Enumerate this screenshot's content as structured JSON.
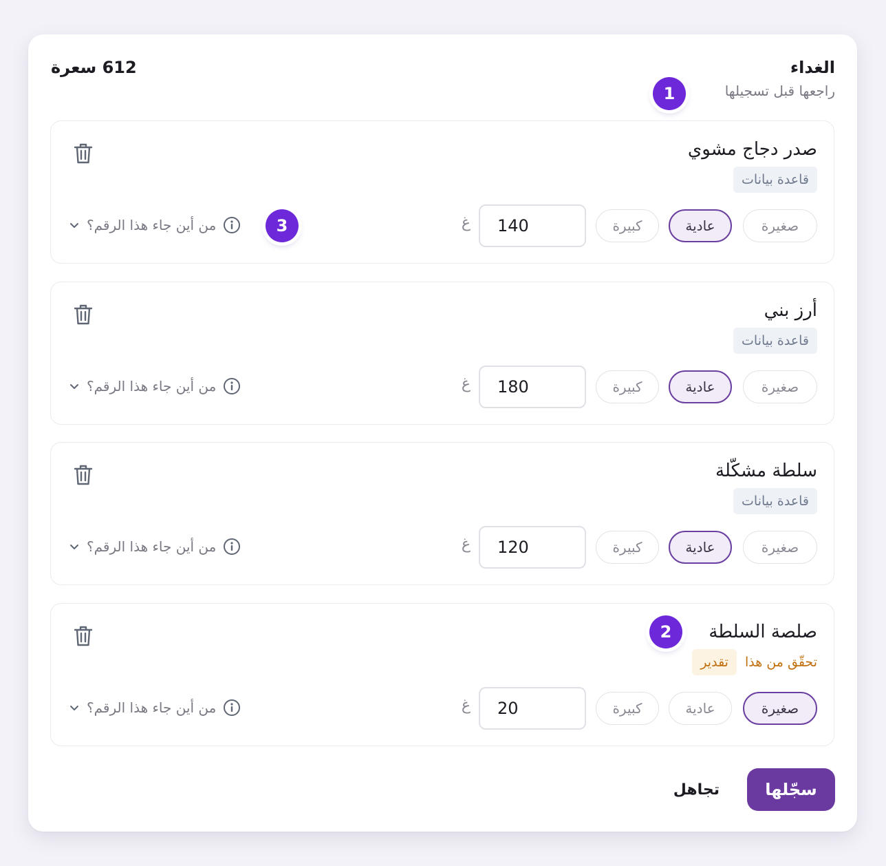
{
  "meal": {
    "title": "الغداء",
    "subtitle": "راجعها قبل تسجيلها",
    "total": "612 سعرة"
  },
  "steps": {
    "one": "1",
    "two": "2",
    "three": "3"
  },
  "sizes": {
    "small": "صغيرة",
    "normal": "عادية",
    "large": "كبيرة"
  },
  "unit": "غ",
  "source_question": "من أين جاء هذا الرقم؟",
  "items": [
    {
      "name": "صدر دجاج مشوي",
      "source": "قاعدة بيانات",
      "grams": "140",
      "selected_size": "normal"
    },
    {
      "name": "أرز بني",
      "source": "قاعدة بيانات",
      "grams": "180",
      "selected_size": "normal"
    },
    {
      "name": "سلطة مشكّلة",
      "source": "قاعدة بيانات",
      "grams": "120",
      "selected_size": "normal"
    },
    {
      "name": "صلصة السلطة",
      "source": "تقدير",
      "note": "تحقّق من هذا",
      "grams": "20",
      "selected_size": "small"
    }
  ],
  "actions": {
    "save": "سجّلها",
    "ignore": "تجاهل"
  },
  "colors": {
    "accent": "#6d28d9",
    "button": "#6b3aa0",
    "estimate": "#c0700e"
  },
  "icons": {
    "delete": "trash-icon",
    "info": "info-icon",
    "expand": "chevron-down-icon"
  }
}
